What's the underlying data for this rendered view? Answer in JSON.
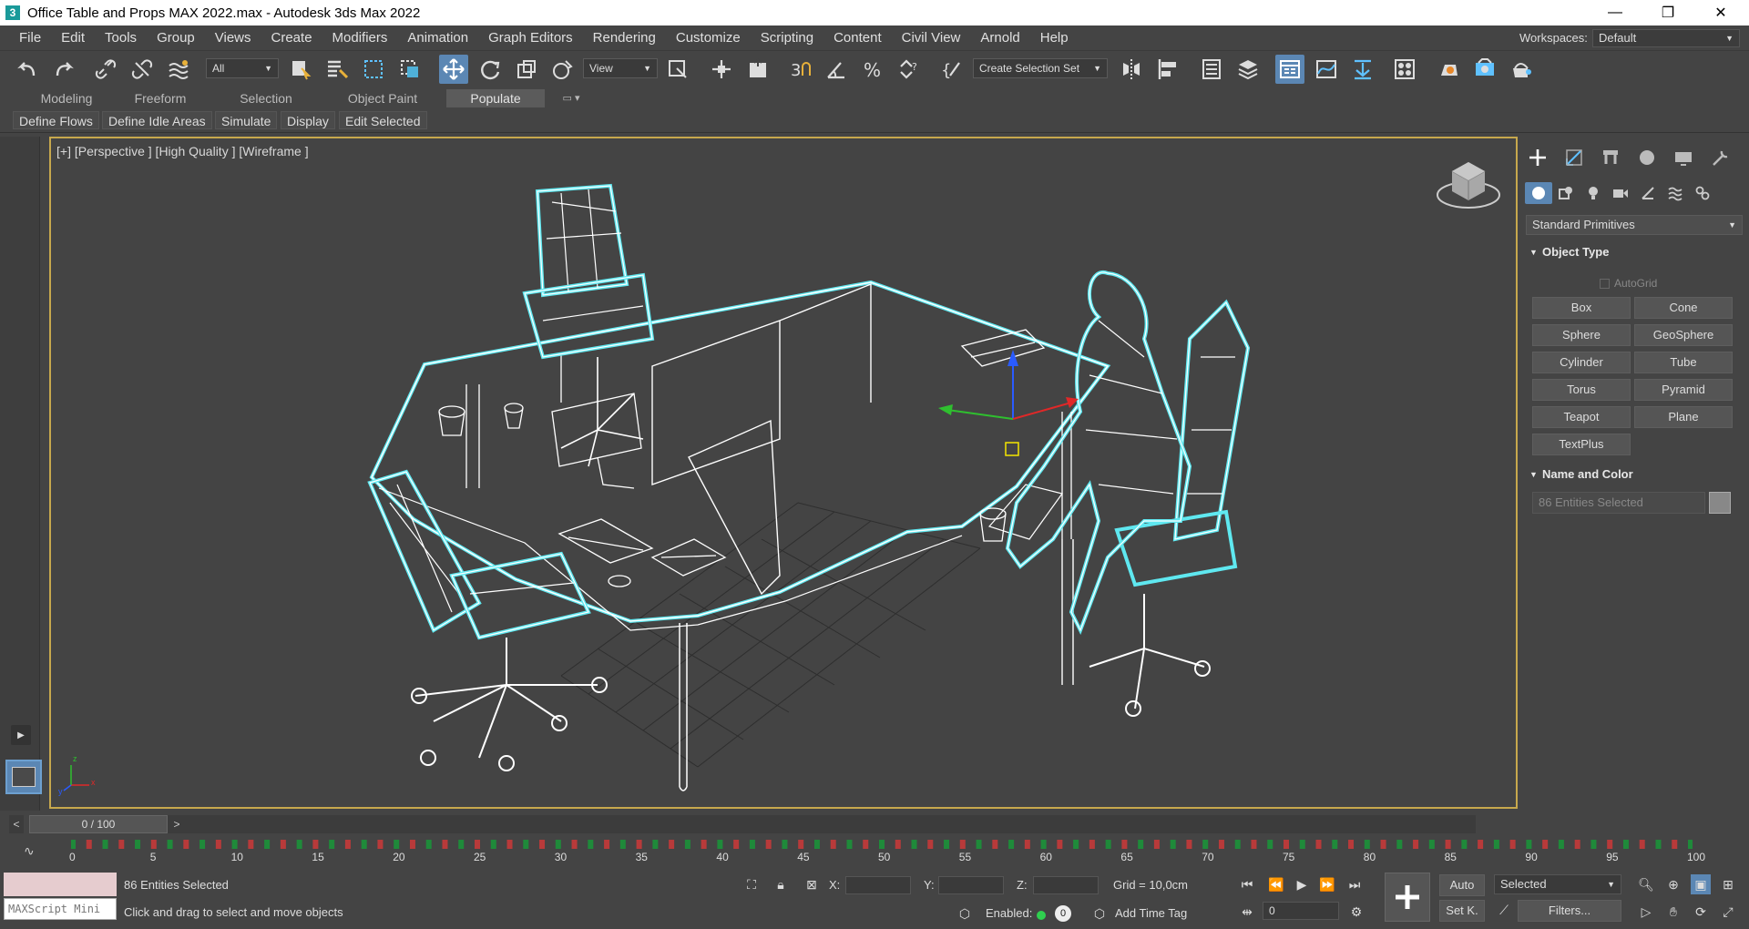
{
  "window": {
    "title": "Office Table and Props MAX 2022.max - Autodesk 3ds Max 2022",
    "app_icon_glyph": "3",
    "minimize": "—",
    "maximize": "❐",
    "close": "✕"
  },
  "menu": {
    "items": [
      "File",
      "Edit",
      "Tools",
      "Group",
      "Views",
      "Create",
      "Modifiers",
      "Animation",
      "Graph Editors",
      "Rendering",
      "Customize",
      "Scripting",
      "Content",
      "Civil View",
      "Arnold",
      "Help"
    ],
    "workspaces_label": "Workspaces:",
    "workspaces_value": "Default"
  },
  "toolbar": {
    "filter_value": "All",
    "refcoord_value": "View",
    "selection_set_value": "Create Selection Set"
  },
  "ribbon": {
    "tabs": [
      "Modeling",
      "Freeform",
      "Selection",
      "Object Paint",
      "Populate"
    ],
    "active_tab": "Populate",
    "buttons": [
      "Define Flows",
      "Define Idle Areas",
      "Simulate",
      "Display",
      "Edit Selected"
    ]
  },
  "viewport": {
    "label": "[+] [Perspective ] [High Quality ] [Wireframe ]",
    "axis_x": "x",
    "axis_y": "y",
    "axis_z": "z"
  },
  "command_panel": {
    "dropdown_value": "Standard Primitives",
    "object_type_title": "Object Type",
    "autogrid_label": "AutoGrid",
    "primitives": [
      "Box",
      "Cone",
      "Sphere",
      "GeoSphere",
      "Cylinder",
      "Tube",
      "Torus",
      "Pyramid",
      "Teapot",
      "Plane",
      "TextPlus"
    ],
    "name_color_title": "Name and Color",
    "name_field_value": "86 Entities Selected"
  },
  "timeslider": {
    "value": "0 / 100",
    "prev": "<",
    "next": ">"
  },
  "trackbar": {
    "numbers": [
      "0",
      "5",
      "10",
      "15",
      "20",
      "25",
      "30",
      "35",
      "40",
      "45",
      "50",
      "55",
      "60",
      "65",
      "70",
      "75",
      "80",
      "85",
      "90",
      "95",
      "100"
    ]
  },
  "status": {
    "maxscript_label": "MAXScript Mini",
    "selection_text": "86 Entities Selected",
    "prompt_text": "Click and drag to select and move objects",
    "x_label": "X:",
    "y_label": "Y:",
    "z_label": "Z:",
    "grid_text": "Grid = 10,0cm",
    "enabled_label": "Enabled:",
    "enabled_value": "0",
    "add_time_tag": "Add Time Tag",
    "auto_label": "Auto",
    "setkey_label": "Set K.",
    "key_filter_value": "Selected",
    "filters_label": "Filters...",
    "frame_value": "0"
  },
  "colors": {
    "accent_blue": "#5b87b4",
    "viewport_border": "#c7a84d",
    "selection_cyan": "#5fe8f0",
    "wire_white": "#ffffff"
  }
}
